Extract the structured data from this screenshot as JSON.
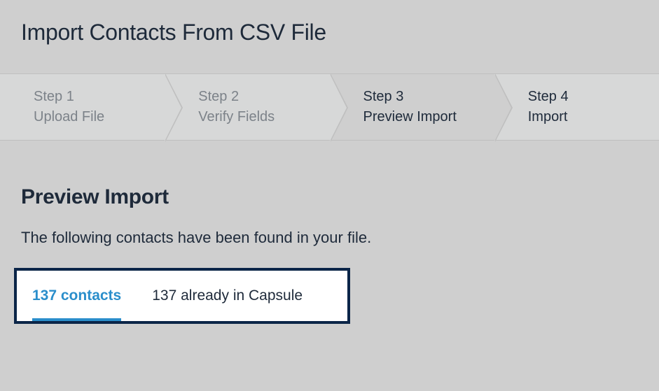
{
  "page": {
    "title": "Import Contacts From CSV File"
  },
  "stepper": {
    "steps": [
      {
        "num": "Step 1",
        "label": "Upload File",
        "state": "past"
      },
      {
        "num": "Step 2",
        "label": "Verify Fields",
        "state": "past"
      },
      {
        "num": "Step 3",
        "label": "Preview Import",
        "state": "active"
      },
      {
        "num": "Step 4",
        "label": "Import",
        "state": "future"
      }
    ]
  },
  "preview": {
    "heading": "Preview Import",
    "subheading": "The following contacts have been found in your file.",
    "tabs": {
      "contacts_tab": "137 contacts",
      "already_tab": "137 already in Capsule"
    }
  }
}
